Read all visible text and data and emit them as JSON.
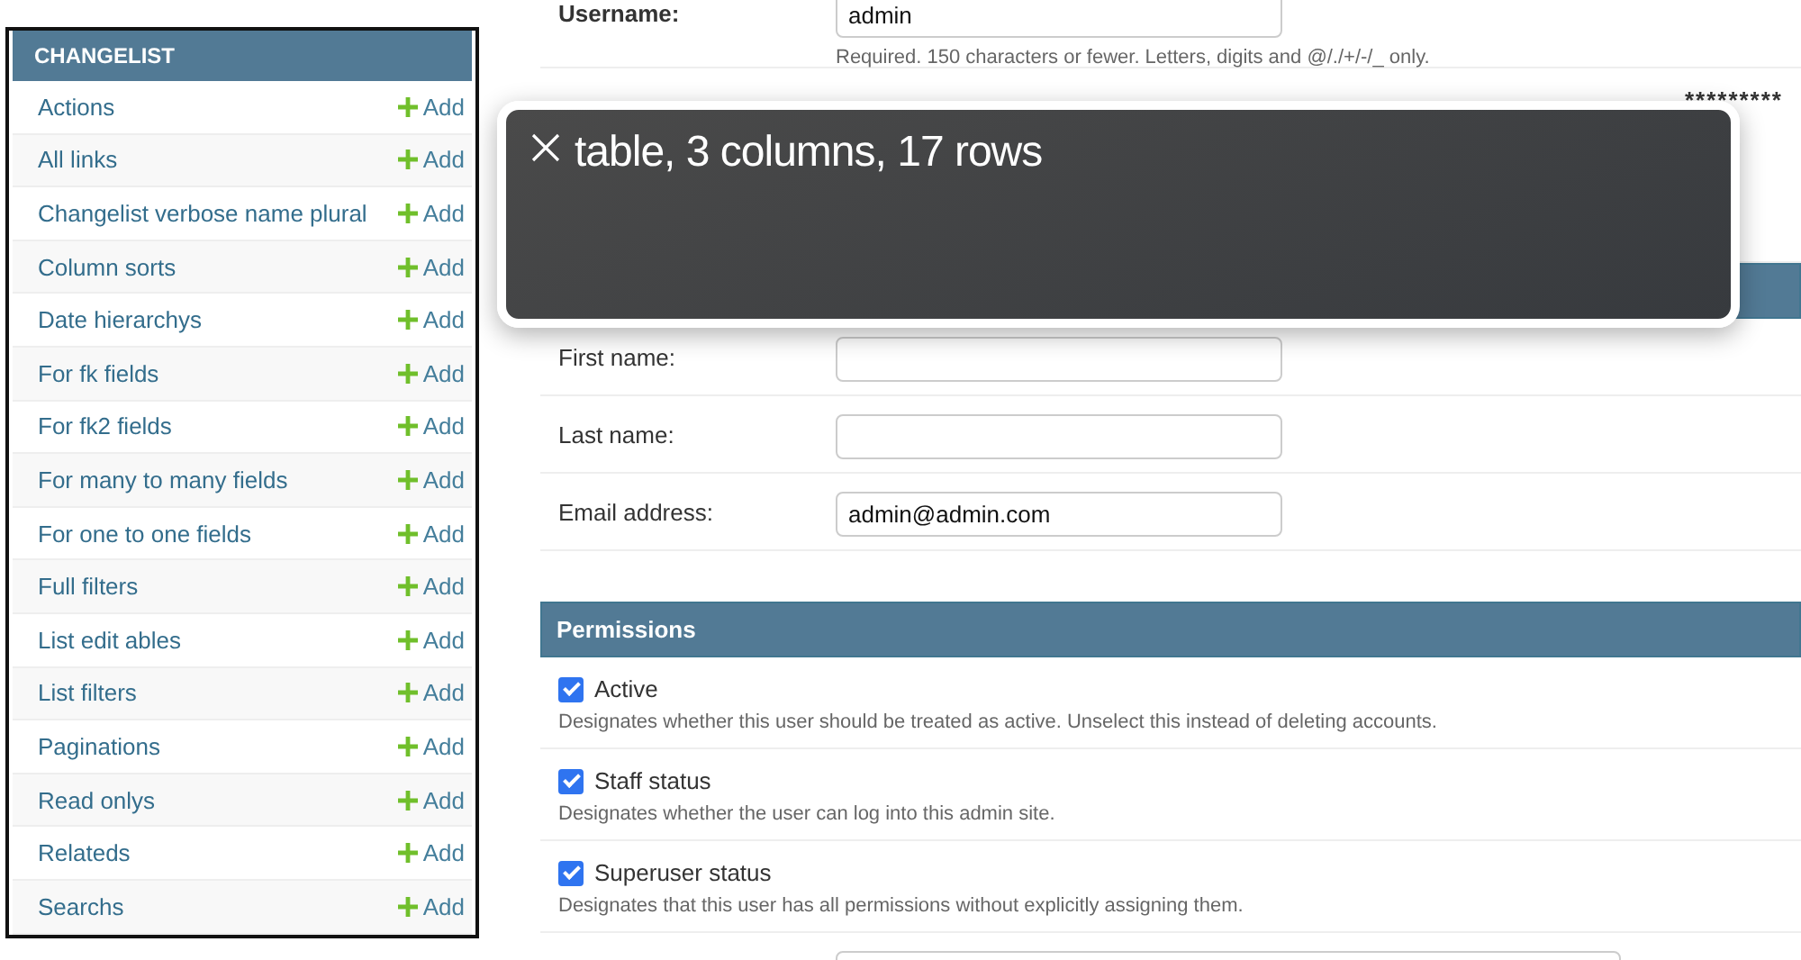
{
  "sidebar": {
    "title": "CHANGELIST",
    "items": [
      {
        "label": "Actions",
        "action": "Add"
      },
      {
        "label": "All links",
        "action": "Add"
      },
      {
        "label": "Changelist verbose name plural",
        "action": "Add"
      },
      {
        "label": "Column sorts",
        "action": "Add"
      },
      {
        "label": "Date hierarchys",
        "action": "Add"
      },
      {
        "label": "For fk fields",
        "action": "Add"
      },
      {
        "label": "For fk2 fields",
        "action": "Add"
      },
      {
        "label": "For many to many fields",
        "action": "Add"
      },
      {
        "label": "For one to one fields",
        "action": "Add"
      },
      {
        "label": "Full filters",
        "action": "Add"
      },
      {
        "label": "List edit ables",
        "action": "Add"
      },
      {
        "label": "List filters",
        "action": "Add"
      },
      {
        "label": "Paginations",
        "action": "Add"
      },
      {
        "label": "Read onlys",
        "action": "Add"
      },
      {
        "label": "Relateds",
        "action": "Add"
      },
      {
        "label": "Searchs",
        "action": "Add"
      }
    ]
  },
  "username": {
    "label": "Username:",
    "value": "admin",
    "help": "Required. 150 characters or fewer. Letters, digits and @/./+/-/_ only."
  },
  "password": {
    "value": "*********"
  },
  "personal_fields": [
    {
      "label": "First name:"
    },
    {
      "label": "Last name:"
    },
    {
      "label": "Email address:",
      "value": "admin@admin.com"
    }
  ],
  "permissions": {
    "title": "Permissions",
    "items": [
      {
        "label": "Active",
        "checked": true,
        "help": "Designates whether this user should be treated as active. Unselect this instead of deleting accounts."
      },
      {
        "label": "Staff status",
        "checked": true,
        "help": "Designates whether the user can log into this admin site."
      },
      {
        "label": "Superuser status",
        "checked": true,
        "help": "Designates that this user has all permissions without explicitly assigning them."
      }
    ]
  },
  "overlay": {
    "text": "table, 3 columns, 17 rows"
  }
}
